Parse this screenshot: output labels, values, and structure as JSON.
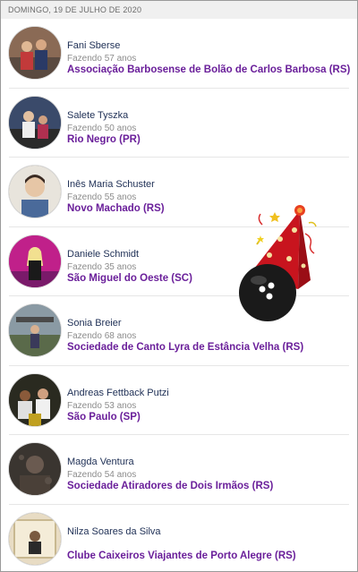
{
  "header": {
    "date": "DOMINGO, 19 DE JULHO DE 2020"
  },
  "items": [
    {
      "name": "Fani Sberse",
      "age": "Fazendo 57 anos",
      "club": "Associação Barbosense de Bolão de Carlos Barbosa (RS)"
    },
    {
      "name": "Salete Tyszka",
      "age": "Fazendo 50 anos",
      "club": "Rio Negro (PR)"
    },
    {
      "name": "Inês Maria Schuster",
      "age": "Fazendo 55 anos",
      "club": "Novo Machado (RS)"
    },
    {
      "name": "Daniele Schmidt",
      "age": "Fazendo 35 anos",
      "club": "São Miguel do Oeste (SC)"
    },
    {
      "name": "Sonia Breier",
      "age": "Fazendo 68 anos",
      "club": "Sociedade de Canto Lyra de Estância Velha (RS)"
    },
    {
      "name": "Andreas Fettback Putzi",
      "age": "Fazendo 53 anos",
      "club": "São Paulo (SP)"
    },
    {
      "name": "Magda Ventura",
      "age": "Fazendo 54 anos",
      "club": "Sociedade Atiradores de Dois Irmãos (RS)"
    },
    {
      "name": "Nilza Soares da Silva",
      "age": "",
      "club": "Clube Caixeiros Viajantes de Porto Alegre (RS)"
    }
  ],
  "colors": {
    "name": "#1e2f55",
    "club": "#6a1f9a",
    "age": "#8c8c8c"
  },
  "decoration": {
    "icon": "party-hat-bowling-ball-icon"
  }
}
